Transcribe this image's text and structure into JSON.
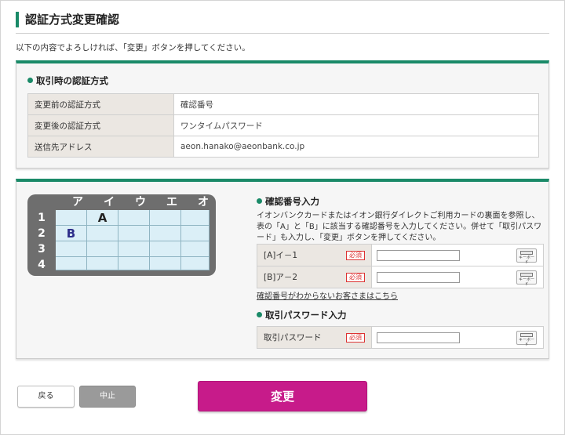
{
  "page": {
    "title": "認証方式変更確認",
    "intro": "以下の内容でよろしければ、「変更」ボタンを押してください。"
  },
  "current_method_section": {
    "heading": "取引時の認証方式",
    "rows": [
      {
        "label": "変更前の認証方式",
        "value": "確認番号"
      },
      {
        "label": "変更後の認証方式",
        "value": "ワンタイムパスワード"
      },
      {
        "label": "送信先アドレス",
        "value": "aeon.hanako@aeonbank.co.jp"
      }
    ]
  },
  "security_card": {
    "columns": [
      "ア",
      "イ",
      "ウ",
      "エ",
      "オ"
    ],
    "rows": [
      "1",
      "2",
      "3",
      "4"
    ],
    "marks": {
      "A": "A",
      "B": "B"
    },
    "colors": {
      "frame": "#6e6e6e",
      "cell": "#dbeff7",
      "mark_a": "#222222",
      "mark_b": "#2e2e8a"
    }
  },
  "confirmation_section": {
    "heading": "確認番号入力",
    "description": "イオンバンクカードまたはイオン銀行ダイレクトご利用カードの裏面を参照し、表の「A」と「B」に該当する確認番号を入力してください。併せて「取引パスワード」も入力し、「変更」ボタンを押してください。",
    "fields": [
      {
        "label": "[A]イ－1",
        "required": "必須",
        "keyboard": "キーボード",
        "value": ""
      },
      {
        "label": "[B]ア－2",
        "required": "必須",
        "keyboard": "キーボード",
        "value": ""
      }
    ],
    "help_link": "確認番号がわからないお客さまはこちら"
  },
  "password_section": {
    "heading": "取引パスワード入力",
    "field": {
      "label": "取引パスワード",
      "required": "必須",
      "keyboard": "キーボード",
      "value": ""
    }
  },
  "buttons": {
    "back": "戻る",
    "cancel": "中止",
    "change": "変更"
  },
  "colors": {
    "accent_green": "#1a8a68",
    "primary_button": "#c71b8a",
    "cancel_button": "#9a9a9a",
    "label_bg": "#ebe7e2",
    "required_red": "#dd3333"
  }
}
